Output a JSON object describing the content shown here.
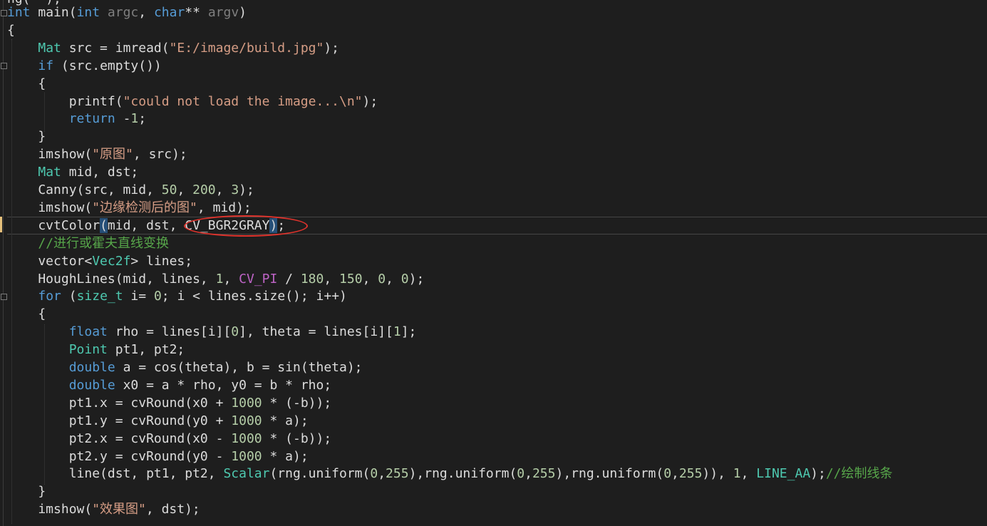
{
  "editor": {
    "language": "C++",
    "theme_colors": {
      "background": "#1e1e1e",
      "keyword": "#569cd6",
      "type": "#4ec9b0",
      "string": "#d69d85",
      "number": "#b5cea8",
      "comment": "#57a64a",
      "macro": "#bd63c5",
      "annotation": "#e0332c"
    },
    "partial_top_line": "ng(  );  ",
    "lines": [
      [
        {
          "c": "kw",
          "t": "int"
        },
        {
          "c": "def",
          "t": " main("
        },
        {
          "c": "kw",
          "t": "int"
        },
        {
          "c": "par",
          "t": " argc"
        },
        {
          "c": "def",
          "t": ", "
        },
        {
          "c": "kw",
          "t": "char"
        },
        {
          "c": "def",
          "t": "** "
        },
        {
          "c": "par",
          "t": "argv"
        },
        {
          "c": "def",
          "t": ")"
        }
      ],
      [
        {
          "c": "def",
          "t": "{"
        }
      ],
      [
        {
          "c": "def",
          "t": "    "
        },
        {
          "c": "ty",
          "t": "Mat"
        },
        {
          "c": "def",
          "t": " src = imread("
        },
        {
          "c": "str",
          "t": "\"E:/image/build.jpg\""
        },
        {
          "c": "def",
          "t": ");"
        }
      ],
      [
        {
          "c": "def",
          "t": "    "
        },
        {
          "c": "kw",
          "t": "if"
        },
        {
          "c": "def",
          "t": " (src.empty())"
        }
      ],
      [
        {
          "c": "def",
          "t": "    {"
        }
      ],
      [
        {
          "c": "def",
          "t": "        printf("
        },
        {
          "c": "str",
          "t": "\"could not load the image...\\n\""
        },
        {
          "c": "def",
          "t": ");"
        }
      ],
      [
        {
          "c": "def",
          "t": "        "
        },
        {
          "c": "kw",
          "t": "return"
        },
        {
          "c": "def",
          "t": " -"
        },
        {
          "c": "num",
          "t": "1"
        },
        {
          "c": "def",
          "t": ";"
        }
      ],
      [
        {
          "c": "def",
          "t": "    }"
        }
      ],
      [
        {
          "c": "def",
          "t": "    imshow("
        },
        {
          "c": "str",
          "t": "\"原图\""
        },
        {
          "c": "def",
          "t": ", src);"
        }
      ],
      [
        {
          "c": "def",
          "t": "    "
        },
        {
          "c": "ty",
          "t": "Mat"
        },
        {
          "c": "def",
          "t": " mid, dst;"
        }
      ],
      [
        {
          "c": "def",
          "t": "    Canny(src, mid, "
        },
        {
          "c": "num",
          "t": "50"
        },
        {
          "c": "def",
          "t": ", "
        },
        {
          "c": "num",
          "t": "200"
        },
        {
          "c": "def",
          "t": ", "
        },
        {
          "c": "num",
          "t": "3"
        },
        {
          "c": "def",
          "t": ");"
        }
      ],
      [
        {
          "c": "def",
          "t": "    imshow("
        },
        {
          "c": "str",
          "t": "\"边缘检测后的图\""
        },
        {
          "c": "def",
          "t": ", mid);"
        }
      ],
      [
        {
          "c": "def",
          "t": "    cvtColor"
        },
        {
          "c": "brace",
          "t": "("
        },
        {
          "c": "def",
          "t": "mid, dst, CV_BGR2GRAY"
        },
        {
          "c": "brace",
          "t": ")"
        },
        {
          "c": "def",
          "t": ";"
        }
      ],
      [
        {
          "c": "def",
          "t": "    "
        },
        {
          "c": "cmt",
          "t": "//进行或霍夫直线变换"
        }
      ],
      [
        {
          "c": "def",
          "t": "    vector<"
        },
        {
          "c": "ty",
          "t": "Vec2f"
        },
        {
          "c": "def",
          "t": "> lines;"
        }
      ],
      [
        {
          "c": "def",
          "t": "    HoughLines(mid, lines, "
        },
        {
          "c": "num",
          "t": "1"
        },
        {
          "c": "def",
          "t": ", "
        },
        {
          "c": "mac",
          "t": "CV_PI"
        },
        {
          "c": "def",
          "t": " / "
        },
        {
          "c": "num",
          "t": "180"
        },
        {
          "c": "def",
          "t": ", "
        },
        {
          "c": "num",
          "t": "150"
        },
        {
          "c": "def",
          "t": ", "
        },
        {
          "c": "num",
          "t": "0"
        },
        {
          "c": "def",
          "t": ", "
        },
        {
          "c": "num",
          "t": "0"
        },
        {
          "c": "def",
          "t": ");"
        }
      ],
      [
        {
          "c": "def",
          "t": "    "
        },
        {
          "c": "kw",
          "t": "for"
        },
        {
          "c": "def",
          "t": " ("
        },
        {
          "c": "ty",
          "t": "size_t"
        },
        {
          "c": "def",
          "t": " i= "
        },
        {
          "c": "num",
          "t": "0"
        },
        {
          "c": "def",
          "t": "; i < lines.size(); i++)"
        }
      ],
      [
        {
          "c": "def",
          "t": "    {"
        }
      ],
      [
        {
          "c": "def",
          "t": "        "
        },
        {
          "c": "kw",
          "t": "float"
        },
        {
          "c": "def",
          "t": " rho = lines[i]["
        },
        {
          "c": "num",
          "t": "0"
        },
        {
          "c": "def",
          "t": "], theta = lines[i]["
        },
        {
          "c": "num",
          "t": "1"
        },
        {
          "c": "def",
          "t": "];"
        }
      ],
      [
        {
          "c": "def",
          "t": "        "
        },
        {
          "c": "ty",
          "t": "Point"
        },
        {
          "c": "def",
          "t": " pt1, pt2;"
        }
      ],
      [
        {
          "c": "def",
          "t": "        "
        },
        {
          "c": "kw",
          "t": "double"
        },
        {
          "c": "def",
          "t": " a = cos(theta), b = sin(theta);"
        }
      ],
      [
        {
          "c": "def",
          "t": "        "
        },
        {
          "c": "kw",
          "t": "double"
        },
        {
          "c": "def",
          "t": " x0 = a * rho, y0 = b * rho;"
        }
      ],
      [
        {
          "c": "def",
          "t": "        pt1.x = cvRound(x0 + "
        },
        {
          "c": "num",
          "t": "1000"
        },
        {
          "c": "def",
          "t": " * (-b));"
        }
      ],
      [
        {
          "c": "def",
          "t": "        pt1.y = cvRound(y0 + "
        },
        {
          "c": "num",
          "t": "1000"
        },
        {
          "c": "def",
          "t": " * a);"
        }
      ],
      [
        {
          "c": "def",
          "t": "        pt2.x = cvRound(x0 - "
        },
        {
          "c": "num",
          "t": "1000"
        },
        {
          "c": "def",
          "t": " * (-b));"
        }
      ],
      [
        {
          "c": "def",
          "t": "        pt2.y = cvRound(y0 - "
        },
        {
          "c": "num",
          "t": "1000"
        },
        {
          "c": "def",
          "t": " * a);"
        }
      ],
      [
        {
          "c": "def",
          "t": "        line(dst, pt1, pt2, "
        },
        {
          "c": "ty",
          "t": "Scalar"
        },
        {
          "c": "def",
          "t": "(rng.uniform("
        },
        {
          "c": "num",
          "t": "0"
        },
        {
          "c": "def",
          "t": ","
        },
        {
          "c": "num",
          "t": "255"
        },
        {
          "c": "def",
          "t": "),rng.uniform("
        },
        {
          "c": "num",
          "t": "0"
        },
        {
          "c": "def",
          "t": ","
        },
        {
          "c": "num",
          "t": "255"
        },
        {
          "c": "def",
          "t": "),rng.uniform("
        },
        {
          "c": "num",
          "t": "0"
        },
        {
          "c": "def",
          "t": ","
        },
        {
          "c": "num",
          "t": "255"
        },
        {
          "c": "def",
          "t": ")), "
        },
        {
          "c": "num",
          "t": "1"
        },
        {
          "c": "def",
          "t": ", "
        },
        {
          "c": "ty",
          "t": "LINE_AA"
        },
        {
          "c": "def",
          "t": ");"
        },
        {
          "c": "cmt",
          "t": "//绘制线条"
        }
      ],
      [
        {
          "c": "def",
          "t": "    }"
        }
      ],
      [
        {
          "c": "def",
          "t": "    imshow("
        },
        {
          "c": "str",
          "t": "\"效果图\""
        },
        {
          "c": "def",
          "t": ", dst);"
        }
      ]
    ],
    "current_line_index": 12,
    "annotation": {
      "shape": "ellipse",
      "target_text": "CV_BGR2GRAY)"
    }
  }
}
